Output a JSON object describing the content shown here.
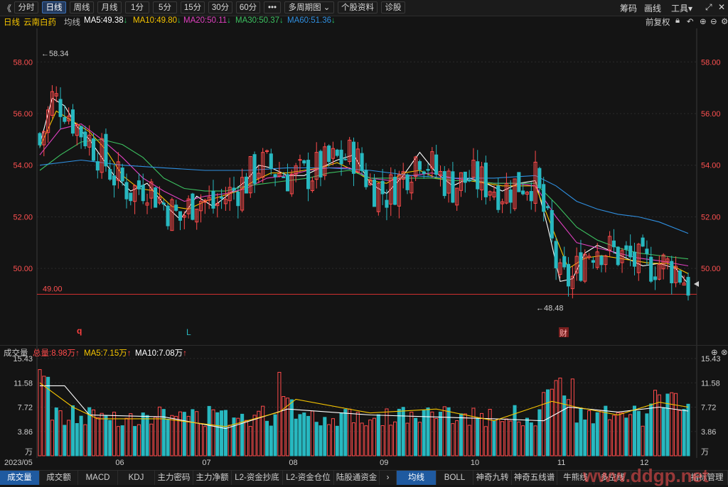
{
  "toolbar": {
    "back": "《",
    "periods": [
      "分时",
      "日线",
      "周线",
      "月线",
      "1分",
      "5分",
      "15分",
      "30分",
      "60分",
      "•••"
    ],
    "active_index": 1,
    "multi": "多周期图",
    "info": "个股资料",
    "diag": "诊股",
    "right": [
      "筹码",
      "画线",
      "工具▾"
    ]
  },
  "legend": {
    "period": "日线",
    "name": "云南白药",
    "type": "均线",
    "ma5": "MA5:49.38",
    "ma10": "MA10:49.80",
    "ma20": "MA20:50.11",
    "ma30": "MA30:50.37",
    "ma60": "MA60:51.36",
    "adj": "前复权"
  },
  "vol_legend": {
    "name": "成交量",
    "total": "总量:8.98万",
    "ma5": "MA5:7.15万",
    "ma10": "MA10:7.08万"
  },
  "annotations": {
    "high": "58.34",
    "low": "48.48",
    "hline": "49.00",
    "mark_q": "q",
    "mark_l": "L",
    "mark_cai": "财",
    "watermark": "www.ddgp.net"
  },
  "bottom_tabs_left": [
    "成交量",
    "成交额",
    "MACD",
    "KDJ",
    "主力密码",
    "主力净额",
    "L2-资金抄底",
    "L2-资金仓位",
    "陆股通资金"
  ],
  "bottom_tabs_right": [
    "均线",
    "BOLL",
    "神奇九转",
    "神奇五线谱",
    "牛熊线",
    "多空线",
    "指标管理"
  ],
  "colors": {
    "up": "#ff4b4b",
    "down": "#28b8c0",
    "ma5": "#ffffff",
    "ma10": "#f5c400",
    "ma20": "#e040c0",
    "ma30": "#3cc060",
    "ma60": "#2f8fe0",
    "hline": "#d03030"
  },
  "chart_data": {
    "type": "candlestick",
    "price_axis": {
      "ticks": [
        "58.00",
        "56.00",
        "54.00",
        "52.00",
        "50.00"
      ],
      "min": 47.2,
      "max": 59.3
    },
    "volume_axis": {
      "ticks": [
        "15.43",
        "11.58",
        "7.72",
        "3.86",
        "万"
      ]
    },
    "x_labels": [
      "2023/05",
      "06",
      "07",
      "08",
      "09",
      "10",
      "11",
      "12"
    ],
    "ma_lines": {
      "ma5": [
        [
          0,
          54.8
        ],
        [
          3,
          56.6
        ],
        [
          6,
          56.3
        ],
        [
          9,
          55.5
        ],
        [
          12,
          55.0
        ],
        [
          15,
          54.3
        ],
        [
          18,
          53.6
        ],
        [
          22,
          53.0
        ],
        [
          26,
          53.3
        ],
        [
          30,
          52.5
        ],
        [
          34,
          51.9
        ],
        [
          38,
          52.8
        ],
        [
          42,
          52.4
        ],
        [
          46,
          52.9
        ],
        [
          50,
          53.4
        ],
        [
          53,
          54.0
        ],
        [
          56,
          53.9
        ],
        [
          60,
          53.6
        ],
        [
          64,
          53.6
        ],
        [
          68,
          53.9
        ],
        [
          72,
          54.2
        ],
        [
          76,
          54.4
        ],
        [
          80,
          53.3
        ],
        [
          84,
          52.9
        ],
        [
          88,
          53.6
        ],
        [
          92,
          54.5
        ],
        [
          96,
          53.7
        ],
        [
          100,
          53.2
        ],
        [
          104,
          53.5
        ],
        [
          108,
          53.3
        ],
        [
          112,
          53.0
        ],
        [
          116,
          53.3
        ],
        [
          120,
          53.4
        ],
        [
          123,
          51.6
        ],
        [
          126,
          49.5
        ],
        [
          129,
          49.6
        ],
        [
          132,
          50.6
        ],
        [
          135,
          50.9
        ],
        [
          138,
          50.7
        ],
        [
          142,
          50.4
        ],
        [
          146,
          50.1
        ],
        [
          150,
          50.2
        ],
        [
          154,
          50.0
        ],
        [
          157,
          49.4
        ]
      ],
      "ma10": [
        [
          0,
          54.7
        ],
        [
          4,
          56.1
        ],
        [
          8,
          55.7
        ],
        [
          12,
          55.3
        ],
        [
          16,
          54.6
        ],
        [
          20,
          53.6
        ],
        [
          24,
          53.1
        ],
        [
          28,
          53.0
        ],
        [
          32,
          52.4
        ],
        [
          36,
          52.3
        ],
        [
          40,
          52.6
        ],
        [
          44,
          52.8
        ],
        [
          48,
          53.0
        ],
        [
          52,
          53.4
        ],
        [
          56,
          53.7
        ],
        [
          60,
          53.7
        ],
        [
          64,
          53.8
        ],
        [
          68,
          53.9
        ],
        [
          72,
          54.1
        ],
        [
          76,
          53.8
        ],
        [
          80,
          53.4
        ],
        [
          84,
          53.3
        ],
        [
          88,
          53.7
        ],
        [
          92,
          53.8
        ],
        [
          96,
          53.5
        ],
        [
          100,
          53.4
        ],
        [
          104,
          53.4
        ],
        [
          108,
          53.3
        ],
        [
          112,
          53.2
        ],
        [
          116,
          53.2
        ],
        [
          120,
          53.2
        ],
        [
          124,
          51.6
        ],
        [
          128,
          50.0
        ],
        [
          132,
          50.4
        ],
        [
          136,
          50.5
        ],
        [
          140,
          50.4
        ],
        [
          144,
          50.3
        ],
        [
          148,
          50.2
        ],
        [
          152,
          50.2
        ],
        [
          157,
          49.8
        ]
      ],
      "ma20": [
        [
          0,
          54.4
        ],
        [
          5,
          55.4
        ],
        [
          10,
          55.6
        ],
        [
          15,
          55.0
        ],
        [
          20,
          54.3
        ],
        [
          25,
          53.5
        ],
        [
          30,
          53.0
        ],
        [
          35,
          52.6
        ],
        [
          40,
          52.8
        ],
        [
          45,
          52.9
        ],
        [
          50,
          53.1
        ],
        [
          55,
          53.5
        ],
        [
          60,
          53.6
        ],
        [
          65,
          53.8
        ],
        [
          70,
          53.9
        ],
        [
          75,
          53.9
        ],
        [
          80,
          53.5
        ],
        [
          85,
          53.4
        ],
        [
          90,
          53.6
        ],
        [
          95,
          53.7
        ],
        [
          100,
          53.5
        ],
        [
          105,
          53.4
        ],
        [
          110,
          53.3
        ],
        [
          115,
          53.3
        ],
        [
          120,
          53.2
        ],
        [
          125,
          52.0
        ],
        [
          130,
          51.0
        ],
        [
          135,
          50.8
        ],
        [
          140,
          50.6
        ],
        [
          145,
          50.4
        ],
        [
          150,
          50.3
        ],
        [
          157,
          50.1
        ]
      ],
      "ma30": [
        [
          0,
          53.8
        ],
        [
          5,
          54.4
        ],
        [
          10,
          54.9
        ],
        [
          15,
          55.0
        ],
        [
          20,
          54.8
        ],
        [
          25,
          54.3
        ],
        [
          30,
          53.5
        ],
        [
          35,
          53.1
        ],
        [
          40,
          53.0
        ],
        [
          45,
          53.0
        ],
        [
          50,
          53.2
        ],
        [
          55,
          53.3
        ],
        [
          60,
          53.4
        ],
        [
          65,
          53.5
        ],
        [
          70,
          53.7
        ],
        [
          75,
          53.8
        ],
        [
          80,
          53.5
        ],
        [
          85,
          53.5
        ],
        [
          90,
          53.5
        ],
        [
          95,
          53.5
        ],
        [
          100,
          53.4
        ],
        [
          105,
          53.4
        ],
        [
          110,
          53.3
        ],
        [
          115,
          53.3
        ],
        [
          120,
          53.3
        ],
        [
          125,
          52.5
        ],
        [
          130,
          51.6
        ],
        [
          135,
          51.1
        ],
        [
          140,
          50.8
        ],
        [
          145,
          50.6
        ],
        [
          150,
          50.5
        ],
        [
          157,
          50.37
        ]
      ],
      "ma60": [
        [
          0,
          54.0
        ],
        [
          10,
          54.2
        ],
        [
          20,
          54.0
        ],
        [
          30,
          53.9
        ],
        [
          40,
          53.8
        ],
        [
          50,
          53.8
        ],
        [
          60,
          53.9
        ],
        [
          70,
          53.9
        ],
        [
          80,
          53.8
        ],
        [
          90,
          53.6
        ],
        [
          100,
          53.5
        ],
        [
          110,
          53.5
        ],
        [
          120,
          53.6
        ],
        [
          125,
          53.2
        ],
        [
          130,
          52.6
        ],
        [
          135,
          52.3
        ],
        [
          140,
          52.1
        ],
        [
          145,
          52.0
        ],
        [
          150,
          51.8
        ],
        [
          157,
          51.36
        ]
      ]
    }
  }
}
